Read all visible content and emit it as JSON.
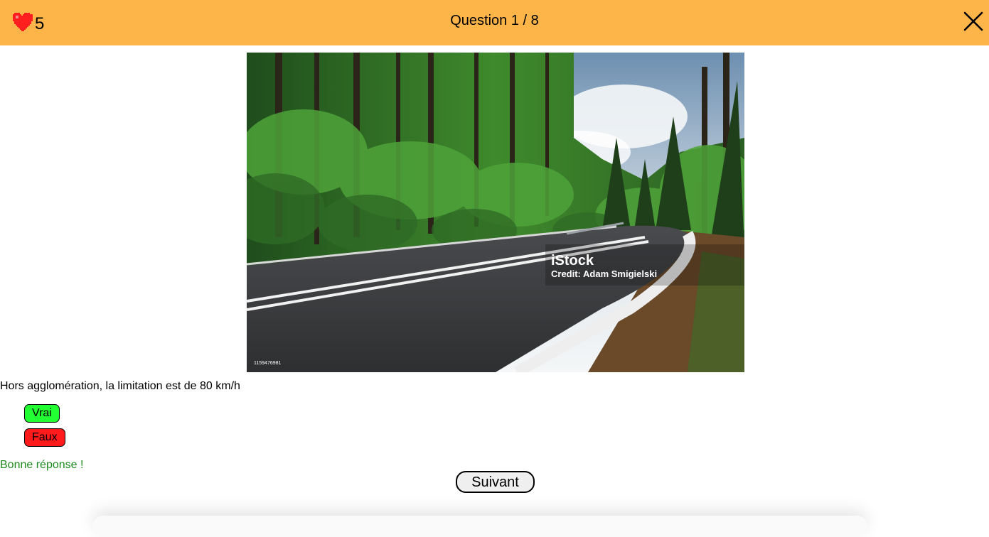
{
  "header": {
    "lives": "5",
    "question_counter": "Question 1 / 8",
    "icons": {
      "lives": "heart-icon",
      "close": "close-icon"
    },
    "background_color": "#fdb54a"
  },
  "photo": {
    "watermark_brand": "iStock",
    "watermark_credit": "Credit: Adam Smigielski",
    "stock_id": "1159476981"
  },
  "question": {
    "text": "Hors agglomération, la limitation est de 80 km/h",
    "answers": [
      {
        "label": "Vrai",
        "color": "#22ff33"
      },
      {
        "label": "Faux",
        "color": "#ff1b1b"
      }
    ],
    "feedback": "Bonne réponse !",
    "feedback_color": "#1c8a1c"
  },
  "footer": {
    "next_label": "Suivant"
  }
}
